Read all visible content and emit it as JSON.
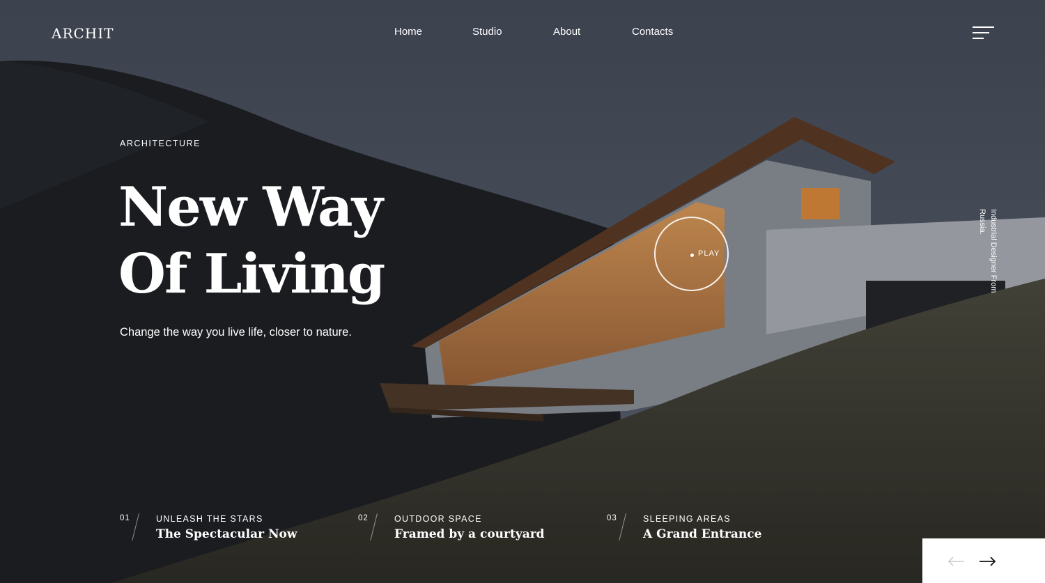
{
  "header": {
    "logo": "ARCHIT",
    "nav": [
      {
        "label": "Home"
      },
      {
        "label": "Studio"
      },
      {
        "label": "About"
      },
      {
        "label": "Contacts"
      }
    ],
    "menu_icon": "hamburger-menu-icon"
  },
  "hero": {
    "eyebrow": "ARCHITECTURE",
    "headline_line1": "New Way",
    "headline_line2": "Of Living",
    "subline": "Change the way you live life, closer to nature.",
    "play_label": "PLAY",
    "vertical_text": "Industrial Designer From Russia."
  },
  "slides": [
    {
      "num": "01",
      "category": "UNLEASH THE STARS",
      "title": "The Spectacular Now"
    },
    {
      "num": "02",
      "category": "OUTDOOR SPACE",
      "title": "Framed by a courtyard"
    },
    {
      "num": "03",
      "category": "SLEEPING AREAS",
      "title": "A Grand Entrance"
    }
  ],
  "controls": {
    "prev_icon": "arrow-left-icon",
    "next_icon": "arrow-right-icon"
  },
  "colors": {
    "sky": "#4a5262",
    "mountain": "#1f2126",
    "grass": "#3a3a30",
    "house_wall": "#9ea3ab",
    "window_light": "#d98a3e",
    "panel": "#ffffff"
  }
}
